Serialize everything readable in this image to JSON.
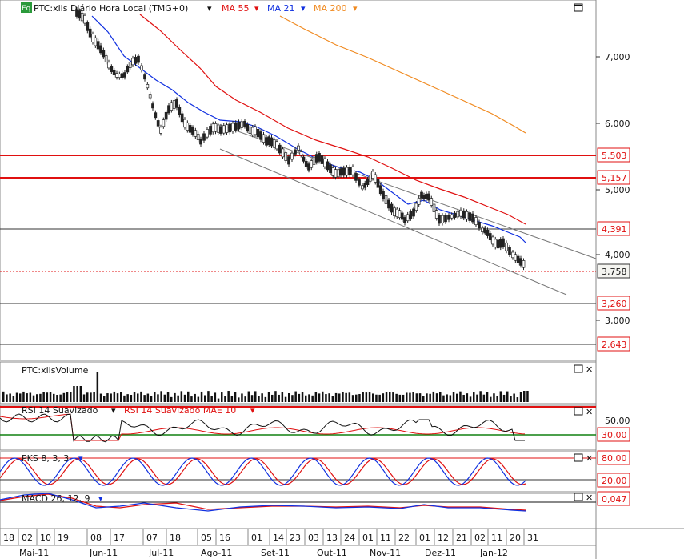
{
  "main": {
    "symbol": "PTC:xlis Diário Hora Local (TMG+0)",
    "eq_badge": "Eq",
    "ma_labels": [
      {
        "text": "MA 55",
        "color": "#e01010"
      },
      {
        "text": "MA 21",
        "color": "#1030e0"
      },
      {
        "text": "MA 200",
        "color": "#f08a20"
      }
    ],
    "axis_ticks": [
      "7,000",
      "6,000",
      "5,000",
      "4,000",
      "3,000"
    ],
    "level_labels": [
      "5,503",
      "5,157",
      "4,391",
      "3,758",
      "3,260",
      "2,643"
    ],
    "icon": "maximize-icon"
  },
  "volume": {
    "title": "PTC:xlisVolume"
  },
  "rsi": {
    "title1": "RSI 14 Suavizado",
    "title2": "RSI 14 Suavizado MAE 10",
    "tick": "50,00",
    "level": "30,00"
  },
  "pks": {
    "title": "PKS 8, 3, 3",
    "level_hi": "80,00",
    "level_lo": "20,00"
  },
  "macd": {
    "title": "MACD 26, 12, 9",
    "level": "0,047"
  },
  "date_axis": {
    "days": [
      "18",
      "02",
      "10",
      "19",
      "08",
      "17",
      "07",
      "18",
      "05",
      "16",
      "01",
      "14",
      "23",
      "03",
      "13",
      "24",
      "01",
      "11",
      "22",
      "01",
      "12",
      "21",
      "02",
      "11",
      "20",
      "31"
    ],
    "months": [
      "Mai-11",
      "Jun-11",
      "Jul-11",
      "Ago-11",
      "Set-11",
      "Out-11",
      "Nov-11",
      "Dez-11",
      "Jan-12"
    ]
  },
  "colors": {
    "ma55": "#e01010",
    "ma21": "#1030e0",
    "ma200": "#f08a20",
    "level_red": "#e01010",
    "rsi_green": "#108010"
  }
}
